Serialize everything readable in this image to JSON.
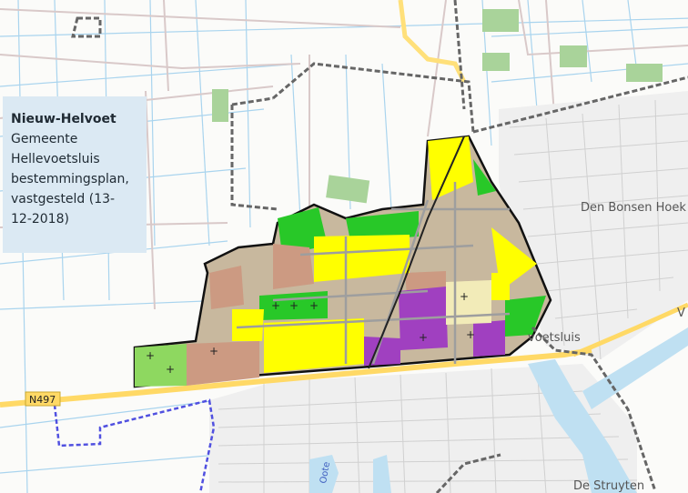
{
  "info_panel": {
    "title": "Nieuw-Helvoet",
    "municipality": "Gemeente",
    "municipality_name": "Hellevoetsluis",
    "plan_type": "bestemmingsplan,",
    "status": "vastgesteld (13-",
    "date": "12-2018)"
  },
  "map_labels": {
    "den_bonsen_hoek": "Den Bonsen Hoek",
    "hellevoetsluis": "voetsluis",
    "de_struyten": "De Struyten",
    "road_n497": "N497",
    "oote": "Oote",
    "road_v": "V"
  },
  "colors": {
    "water": "#bfe0f2",
    "residential_yellow": "#ffff00",
    "green": "#28c828",
    "sport_green": "#8ed860",
    "mixed_brown": "#cc9a82",
    "social_purple": "#a040c0",
    "culture_beige": "#f2ebb8",
    "road_yellow": "#ffd966",
    "boundary": "#555555",
    "blue_route": "#5050e0"
  }
}
